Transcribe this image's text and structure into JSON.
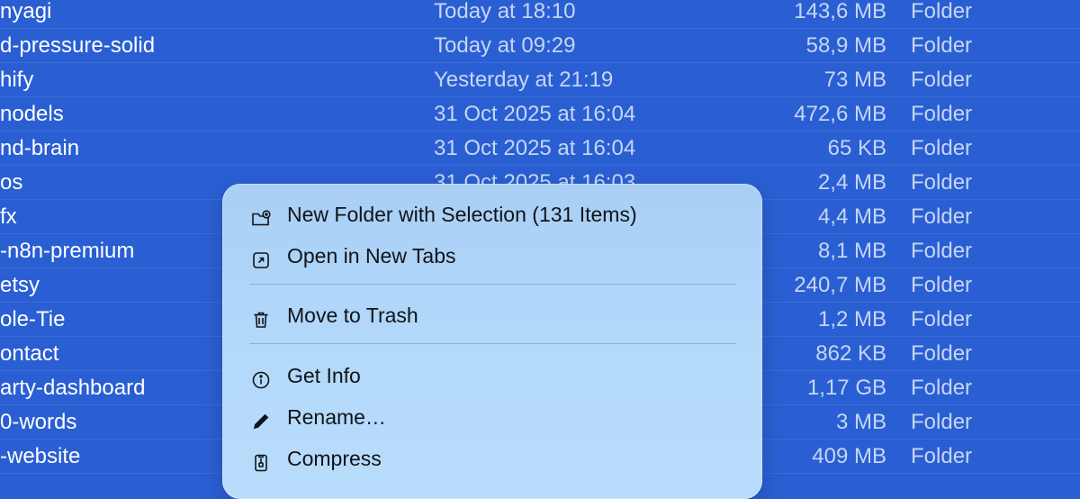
{
  "rows": [
    {
      "name": "nyagi",
      "date": "Today at 18:10",
      "size": "143,6 MB",
      "kind": "Folder"
    },
    {
      "name": "d-pressure-solid",
      "date": "Today at 09:29",
      "size": "58,9 MB",
      "kind": "Folder"
    },
    {
      "name": "hify",
      "date": "Yesterday at 21:19",
      "size": "73 MB",
      "kind": "Folder"
    },
    {
      "name": "nodels",
      "date": "31 Oct 2025 at 16:04",
      "size": "472,6 MB",
      "kind": "Folder"
    },
    {
      "name": "nd-brain",
      "date": "31 Oct 2025 at 16:04",
      "size": "65 KB",
      "kind": "Folder"
    },
    {
      "name": "os",
      "date": "31 Oct 2025 at 16:03",
      "size": "2,4 MB",
      "kind": "Folder"
    },
    {
      "name": "fx",
      "date": "",
      "size": "4,4 MB",
      "kind": "Folder"
    },
    {
      "name": "-n8n-premium",
      "date": "",
      "size": "8,1 MB",
      "kind": "Folder"
    },
    {
      "name": "etsy",
      "date": "",
      "size": "240,7 MB",
      "kind": "Folder"
    },
    {
      "name": "ole-Tie",
      "date": "",
      "size": "1,2 MB",
      "kind": "Folder"
    },
    {
      "name": "ontact",
      "date": "",
      "size": "862 KB",
      "kind": "Folder"
    },
    {
      "name": "arty-dashboard",
      "date": "",
      "size": "1,17 GB",
      "kind": "Folder"
    },
    {
      "name": "0-words",
      "date": "",
      "size": "3 MB",
      "kind": "Folder"
    },
    {
      "name": "-website",
      "date": "",
      "size": "409 MB",
      "kind": "Folder"
    }
  ],
  "context_menu": {
    "new_folder_with_selection": "New Folder with Selection (131 Items)",
    "open_in_new_tabs": "Open in New Tabs",
    "move_to_trash": "Move to Trash",
    "get_info": "Get Info",
    "rename": "Rename…",
    "compress": "Compress"
  },
  "colors": {
    "selection_background": "#2a5fd3",
    "menu_background": "#b3d9fb",
    "menu_text": "#111418"
  }
}
